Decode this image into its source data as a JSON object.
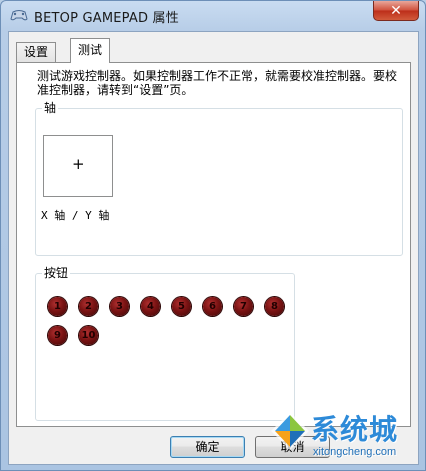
{
  "window": {
    "title": "BETOP GAMEPAD 属性",
    "close_glyph": "✕"
  },
  "tabs": [
    {
      "label": "设置",
      "active": false
    },
    {
      "label": "测试",
      "active": true
    }
  ],
  "panel": {
    "description": "测试游戏控制器。如果控制器工作不正常，就需要校准控制器。要校准控制器，请转到“设置”页。",
    "axis_group": {
      "label": "轴",
      "crosshair": "+",
      "caption": "X 轴 / Y 轴"
    },
    "buttons_group": {
      "label": "按钮",
      "buttons": [
        "1",
        "2",
        "3",
        "4",
        "5",
        "6",
        "7",
        "8",
        "9",
        "10"
      ]
    }
  },
  "footer": {
    "ok_label": "确定",
    "cancel_label": "取消"
  },
  "watermark": {
    "brand": "系统城",
    "url": "xitongcheng.com"
  },
  "colors": {
    "accent": "#2d8ad8",
    "button_dot": "#7a1313"
  }
}
